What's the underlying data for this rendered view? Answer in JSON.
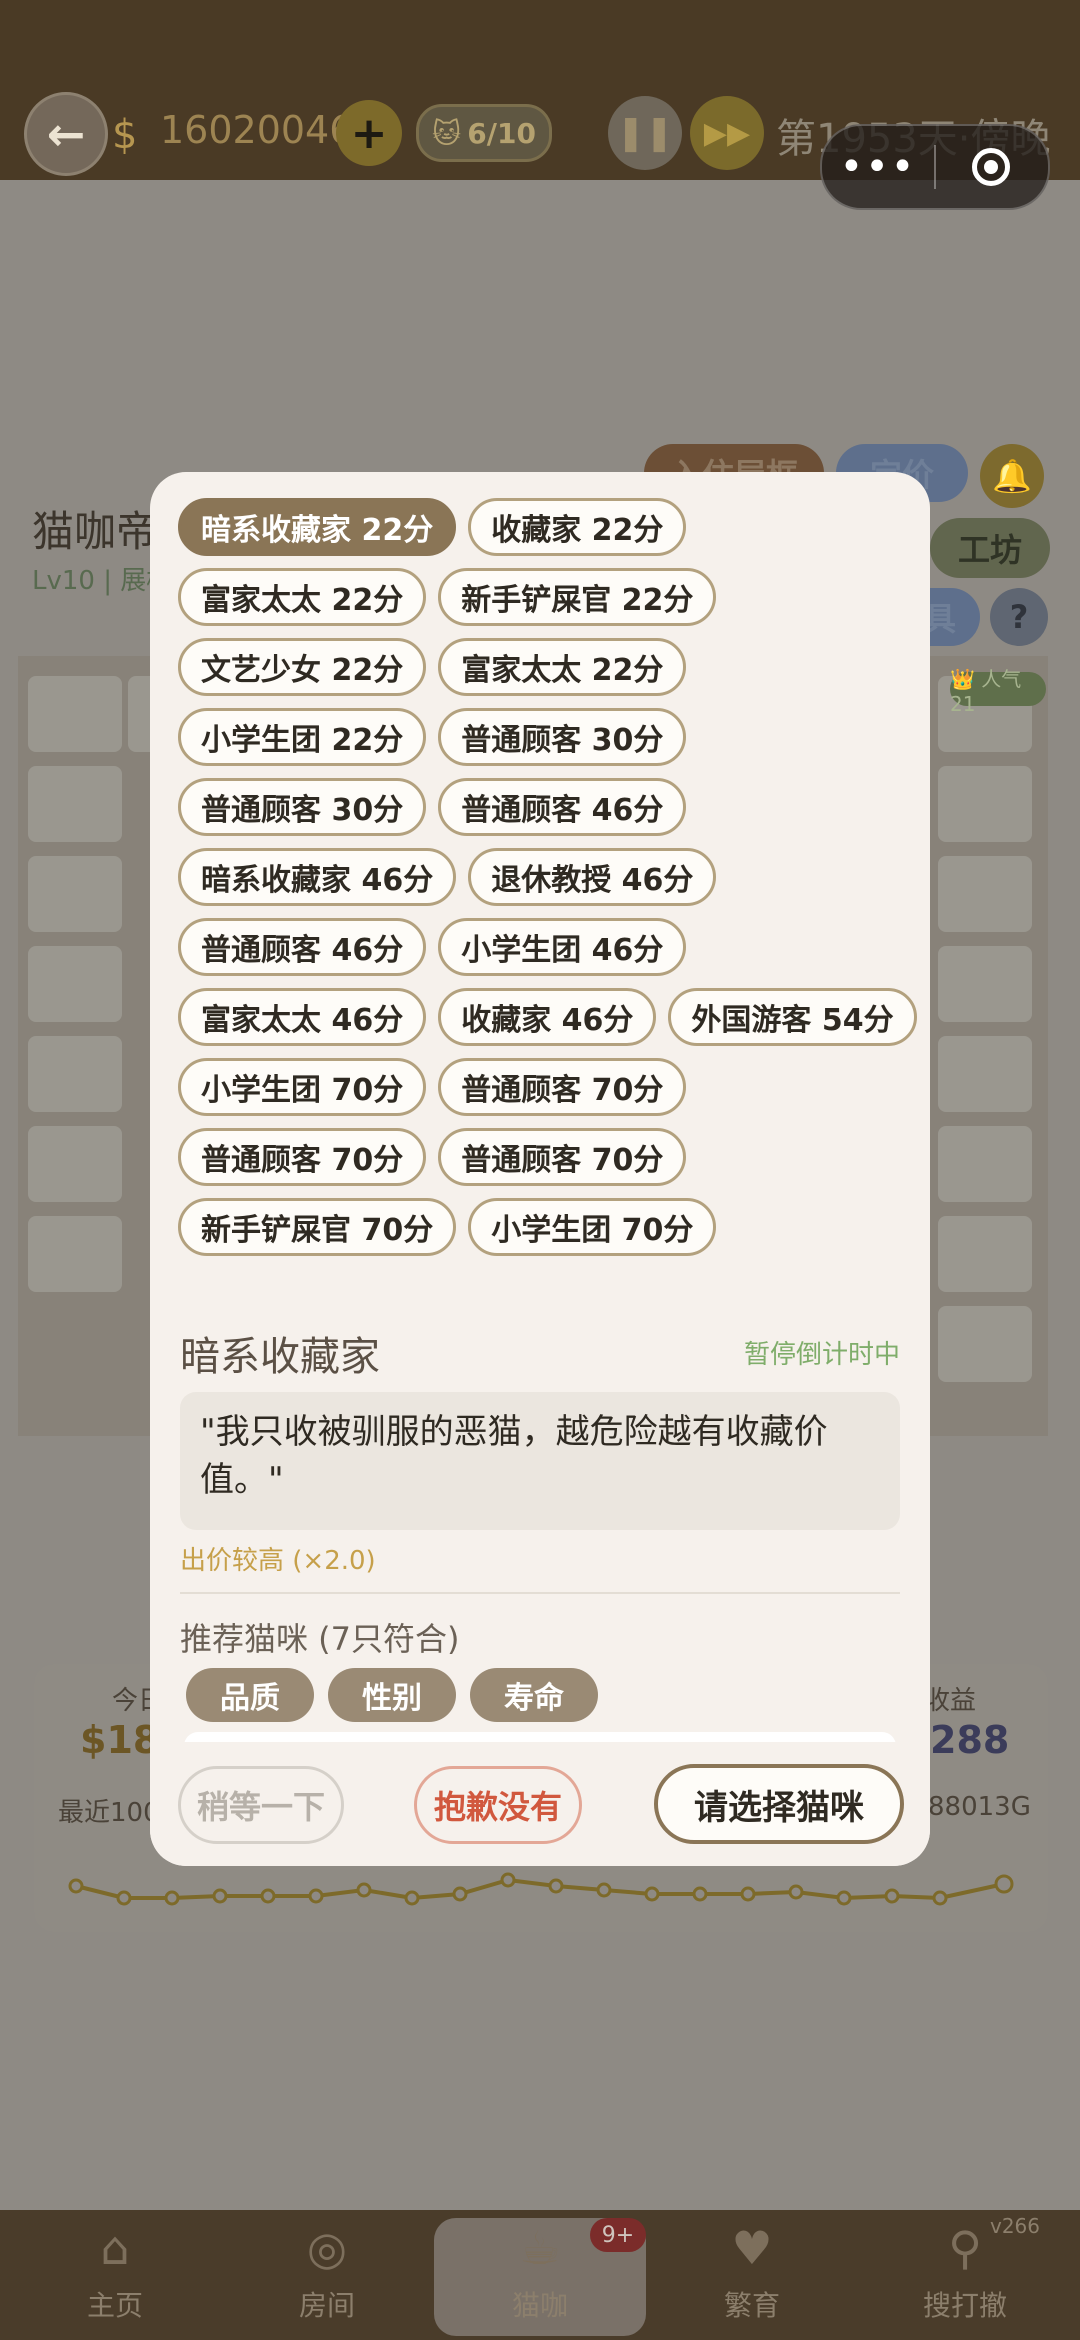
{
  "header": {
    "money": "16020046",
    "cat_capacity": "6/10",
    "day_text": "第1953天·傍晚",
    "capsule_more": "•••",
    "icons": {
      "back": "back-arrow-icon",
      "money": "money-bag-icon",
      "plus": "plus-icon",
      "cat": "cat-icon",
      "pause": "pause-icon",
      "fast_forward": "fast-forward-icon"
    }
  },
  "background": {
    "title": "猫咖帝",
    "subtitle": "Lv10 | 展柜",
    "pill_a": "入住屋框",
    "pill_b": "定价",
    "pill_workshop": "工坊",
    "pill_d": "具",
    "help": "?",
    "popularity": "👑 人气 21",
    "stat_left_label": "今日",
    "stat_left_value": "$18",
    "stat_right_label": "收益",
    "stat_right_value": "288",
    "recent_label": "最近100",
    "recent_total": "88013G"
  },
  "customers": [
    {
      "label": "暗系收藏家 22分",
      "selected": true
    },
    {
      "label": "收藏家 22分"
    },
    {
      "label": "富家太太 22分"
    },
    {
      "label": "新手铲屎官 22分"
    },
    {
      "label": "文艺少女 22分"
    },
    {
      "label": "富家太太 22分"
    },
    {
      "label": "小学生团 22分"
    },
    {
      "label": "普通顾客 30分"
    },
    {
      "label": "普通顾客 30分"
    },
    {
      "label": "普通顾客 46分"
    },
    {
      "label": "暗系收藏家 46分"
    },
    {
      "label": "退休教授 46分"
    },
    {
      "label": "普通顾客 46分"
    },
    {
      "label": "小学生团 46分"
    },
    {
      "label": "富家太太 46分"
    },
    {
      "label": "收藏家 46分"
    },
    {
      "label": "外国游客 54分"
    },
    {
      "label": "小学生团 70分"
    },
    {
      "label": "普通顾客 70分"
    },
    {
      "label": "普通顾客 70分"
    },
    {
      "label": "普通顾客 70分"
    },
    {
      "label": "新手铲屎官 70分"
    },
    {
      "label": "小学生团 70分"
    }
  ],
  "detail": {
    "name": "暗系收藏家",
    "status": "暂停倒计时中",
    "quote": "\"我只收被驯服的恶猫，越危险越有收藏价值。\"",
    "price_note": "出价较高 (×2.0)",
    "recommend_title": "推荐猫咪 (7只符合)",
    "filters": [
      "品质",
      "性别",
      "寿命"
    ]
  },
  "buttons": {
    "wait": "稍等一下",
    "sorry": "抱歉没有",
    "select": "请选择猫咪"
  },
  "bottom_nav": {
    "items": [
      {
        "label": "主页",
        "icon": "house-icon"
      },
      {
        "label": "房间",
        "icon": "room-icon"
      },
      {
        "label": "猫咖",
        "icon": "cat-cafe-icon"
      },
      {
        "label": "繁育",
        "icon": "breeding-icon"
      },
      {
        "label": "搜打撤",
        "icon": "search-icon"
      }
    ],
    "badge": "9+",
    "version": "v266"
  },
  "colors": {
    "accent": "#8a7556",
    "warning": "#d1583e",
    "status_green": "#7fad6a",
    "price_gold": "#c6a04a"
  }
}
